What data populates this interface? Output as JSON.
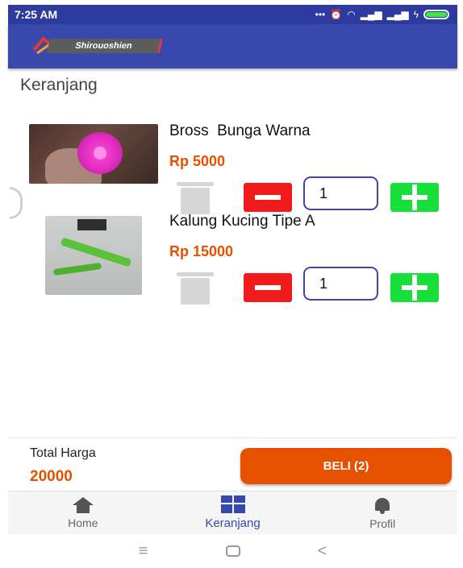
{
  "status_bar": {
    "time": "7:25 AM",
    "icons": [
      "dots",
      "alarm-icon",
      "wifi-icon",
      "signal-icon",
      "signal-icon",
      "charging-icon",
      "battery-icon"
    ],
    "battery_color": "#3ee64a"
  },
  "app_bar": {
    "logo_text": "Shirouoshien",
    "background": "#3949ab"
  },
  "page": {
    "title": "Keranjang"
  },
  "cart": {
    "items": [
      {
        "name": "Bross  Bunga Warna",
        "price": "Rp 5000",
        "quantity": "1"
      },
      {
        "name": "Kalung Kucing Tipe A",
        "price": "Rp 15000",
        "quantity": "1"
      }
    ]
  },
  "summary": {
    "total_label": "Total Harga",
    "total_value": "20000",
    "buy_label": "BELI (2)",
    "accent": "#e65100"
  },
  "bottom_nav": {
    "items": [
      {
        "label": "Home",
        "icon": "home-icon"
      },
      {
        "label": "Keranjang",
        "icon": "dashboard-icon",
        "active": true
      },
      {
        "label": "Profil",
        "icon": "bell-icon"
      }
    ]
  },
  "system_nav": {
    "menu_glyph": "≡",
    "back_glyph": "<"
  }
}
